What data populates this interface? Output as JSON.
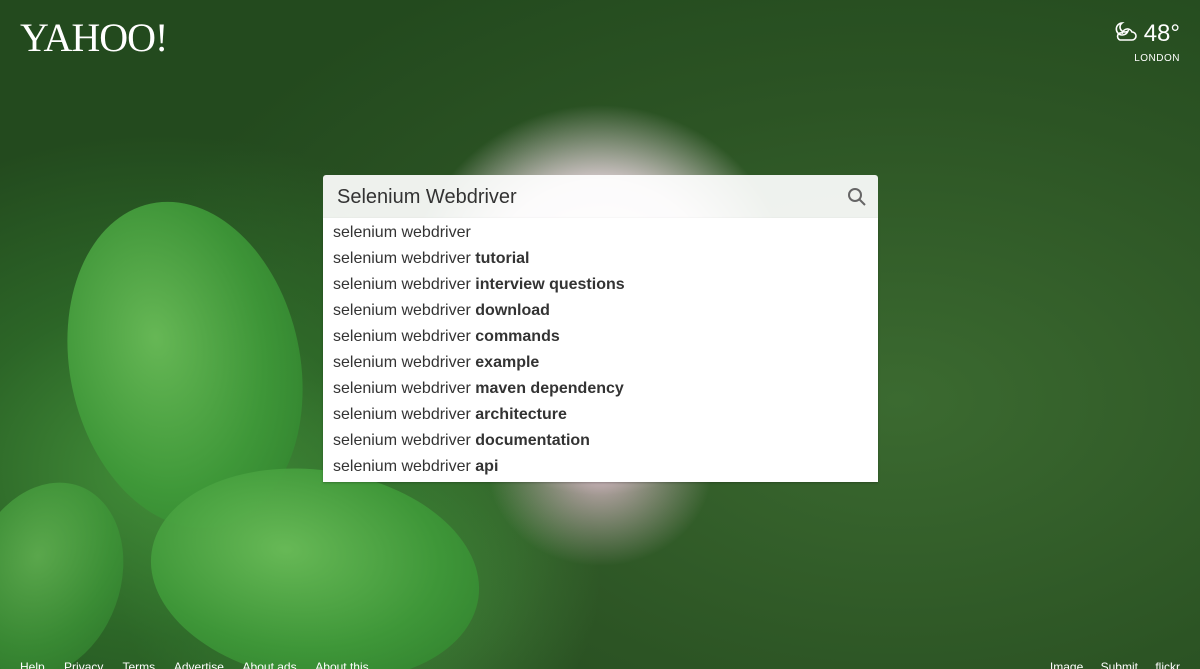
{
  "brand": {
    "logo_text": "YAHOO!"
  },
  "weather": {
    "temperature": "48°",
    "city": "LONDON",
    "icon": "partly-cloudy-night-icon"
  },
  "search": {
    "value": "Selenium Webdriver",
    "button_icon": "search-icon",
    "suggestions": [
      {
        "prefix": "selenium webdriver",
        "bold": ""
      },
      {
        "prefix": "selenium webdriver ",
        "bold": "tutorial"
      },
      {
        "prefix": "selenium webdriver ",
        "bold": "interview questions"
      },
      {
        "prefix": "selenium webdriver ",
        "bold": "download"
      },
      {
        "prefix": "selenium webdriver ",
        "bold": "commands"
      },
      {
        "prefix": "selenium webdriver ",
        "bold": "example"
      },
      {
        "prefix": "selenium webdriver ",
        "bold": "maven dependency"
      },
      {
        "prefix": "selenium webdriver ",
        "bold": "architecture"
      },
      {
        "prefix": "selenium webdriver ",
        "bold": "documentation"
      },
      {
        "prefix": "selenium webdriver ",
        "bold": "api"
      }
    ]
  },
  "footer": {
    "left_links": [
      "Help",
      "Privacy",
      "Terms",
      "Advertise",
      "About ads",
      "About this"
    ],
    "right_links": [
      "Image",
      "Submit",
      "flickr"
    ]
  }
}
